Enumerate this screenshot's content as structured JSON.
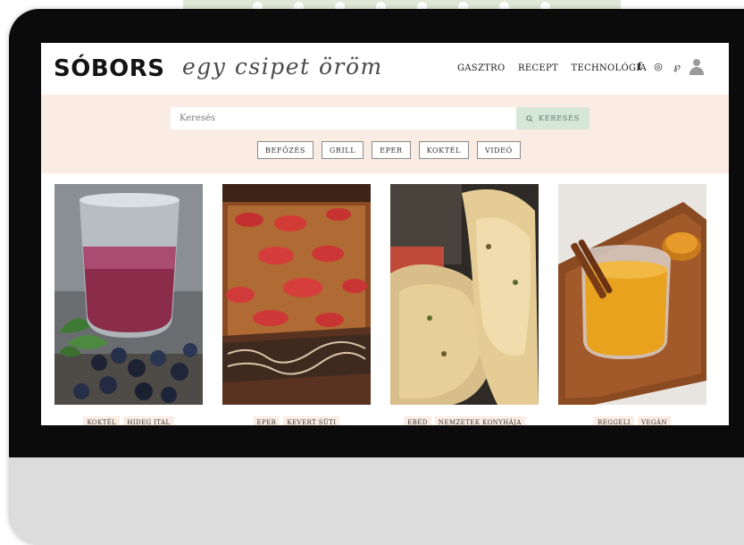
{
  "brand": {
    "logo": "SÓBORS",
    "tagline": "egy csipet öröm"
  },
  "nav": {
    "items": [
      "GASZTRO",
      "RECEPT",
      "TECHNOLÓGIA"
    ]
  },
  "social": {
    "facebook_glyph": "f",
    "instagram_glyph": "◎",
    "pinterest_glyph": "℘"
  },
  "search": {
    "placeholder": "Keresés",
    "button_label": "KERESÉS",
    "button_icon": "search-icon"
  },
  "tag_filters": [
    "BEFŐZÉS",
    "GRILL",
    "EPER",
    "KOKTÉL",
    "VIDEÓ"
  ],
  "cards": [
    {
      "tags": [
        "KOKTÉL",
        "HIDEG ITAL"
      ]
    },
    {
      "tags": [
        "EPER",
        "KEVERT SÜTI"
      ]
    },
    {
      "tags": [
        "EBÉD",
        "NEMZETEK KONYHÁJA"
      ]
    },
    {
      "tags": [
        "REGGELI",
        "VEGÁN"
      ]
    }
  ],
  "colors": {
    "band_background": "#fbece3",
    "search_button": "#d6e6d7",
    "bezel": "#0b0b0b",
    "monitor_frame": "#dcdcdc"
  }
}
